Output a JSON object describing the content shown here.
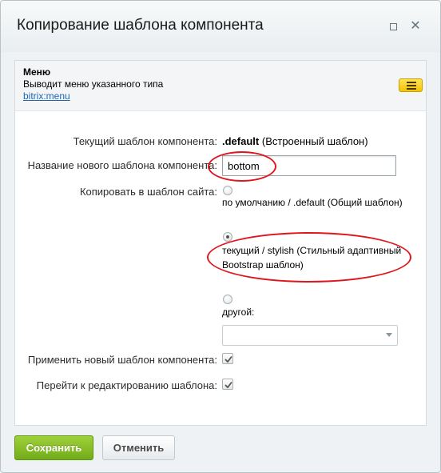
{
  "window": {
    "title": "Копирование шаблона компонента"
  },
  "component": {
    "name": "Меню",
    "description": "Выводит меню указанного типа",
    "link": "bitrix:menu"
  },
  "form": {
    "current_template_label": "Текущий шаблон компонента:",
    "current_template_name": ".default",
    "current_template_note": "(Встроенный шаблон)",
    "new_name_label": "Название нового шаблона компонента:",
    "new_name_value": "bottom",
    "copy_to_label": "Копировать в шаблон сайта:",
    "radio_options": [
      {
        "label": "по умолчанию / .default (Общий шаблон)",
        "checked": false
      },
      {
        "label": "текущий / stylish (Стильный адаптивный Bootstrap шаблон)",
        "checked": true
      },
      {
        "label": "другой:",
        "checked": false
      }
    ],
    "other_select_value": "",
    "apply_label": "Применить новый шаблон компонента:",
    "apply_checked": true,
    "edit_label": "Перейти к редактированию шаблона:",
    "edit_checked": true
  },
  "buttons": {
    "save": "Сохранить",
    "cancel": "Отменить"
  },
  "colors": {
    "accent_green": "#86bd25",
    "annotation_red": "#e0161d",
    "link_blue": "#2067b0"
  }
}
